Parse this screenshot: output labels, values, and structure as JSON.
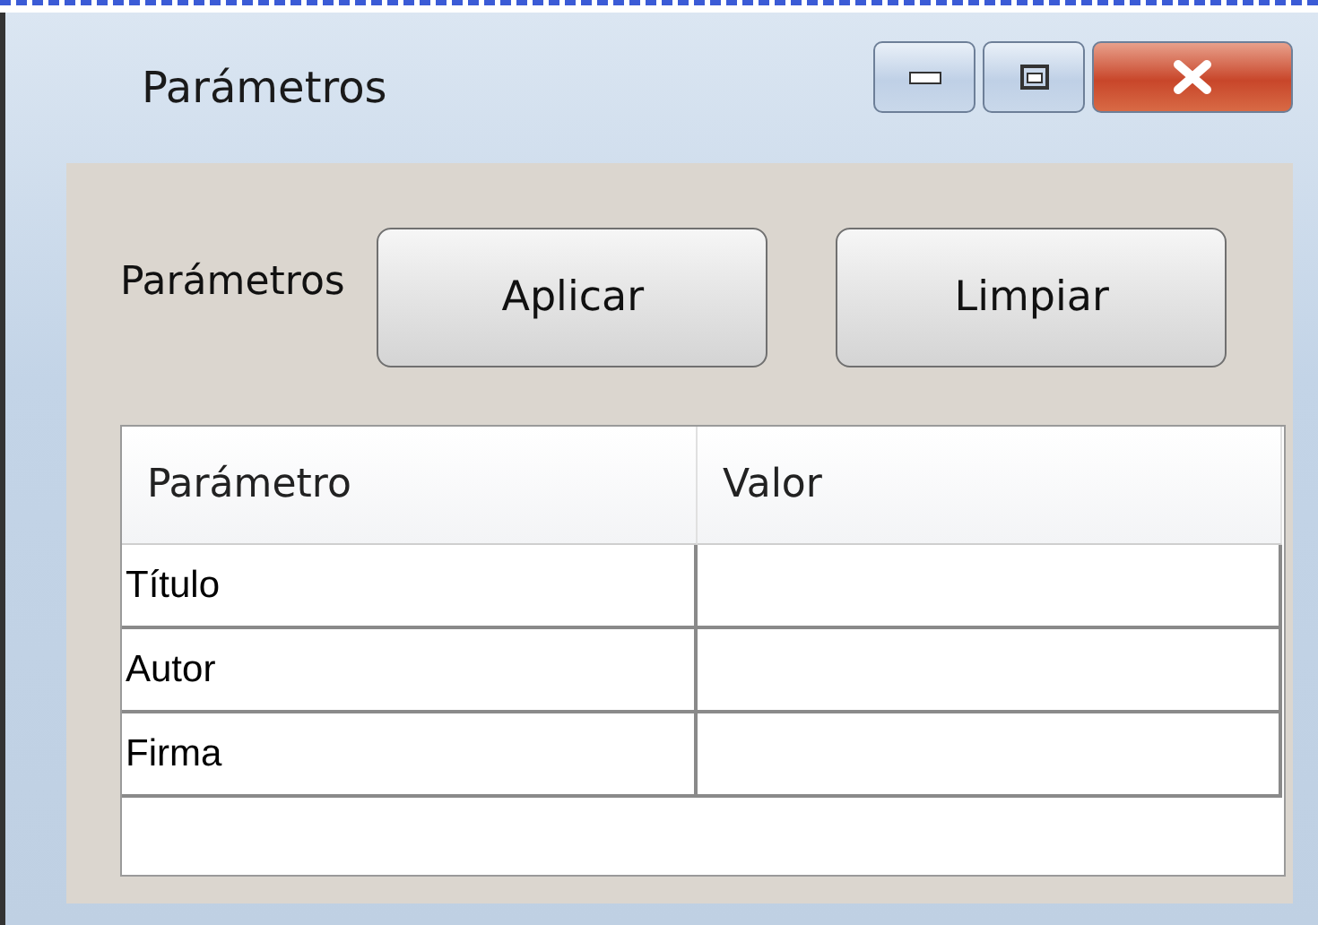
{
  "window": {
    "title": "Parámetros"
  },
  "toolbar": {
    "label": "Parámetros",
    "buttons": [
      "Aplicar",
      "Limpiar"
    ]
  },
  "table": {
    "columns": [
      "Parámetro",
      "Valor"
    ],
    "rows": [
      {
        "cells": [
          "Título",
          ""
        ]
      },
      {
        "cells": [
          "Autor",
          ""
        ]
      },
      {
        "cells": [
          "Firma",
          ""
        ]
      }
    ]
  }
}
